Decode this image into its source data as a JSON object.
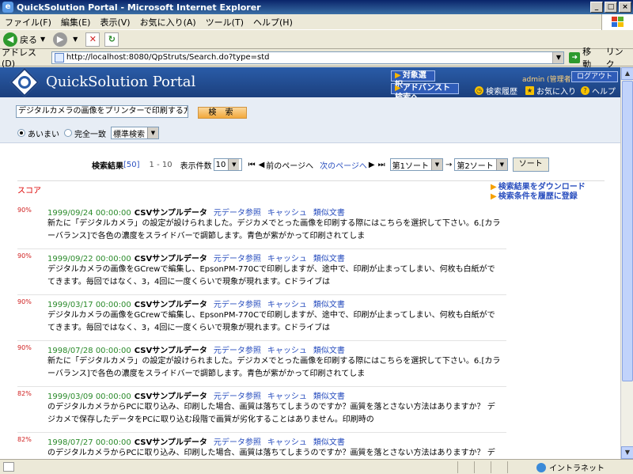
{
  "window": {
    "title": "QuickSolution Portal - Microsoft Internet Explorer",
    "buttons": [
      "_",
      "□",
      "×"
    ]
  },
  "menu": [
    "ファイル(F)",
    "編集(E)",
    "表示(V)",
    "お気に入り(A)",
    "ツール(T)",
    "ヘルプ(H)"
  ],
  "toolbar": {
    "back_label": "戻る"
  },
  "address": {
    "label": "アドレス(D)",
    "url": "http://localhost:8080/QpStruts/Search.do?type=std",
    "go_label": "移動",
    "links_label": "リンク"
  },
  "header": {
    "brand": "QuickSolution Portal",
    "nav": [
      "対象選択",
      "アドバンスト検索へ"
    ],
    "admin": "admin (管理者)",
    "logout": "ログアウト",
    "util_links": [
      "検索履歴",
      "お気に入り",
      "ヘルプ"
    ]
  },
  "search": {
    "query": "デジタルカメラの画像をプリンターで印刷する方法は",
    "button": "検 索",
    "match_options": [
      "あいまい",
      "完全一致"
    ],
    "mode_value": "標準検索"
  },
  "results_bar": {
    "label": "検索結果",
    "count": "[50]",
    "range": "1 - 10",
    "per_page_label": "表示件数",
    "per_page_value": "10",
    "prev": "前のページへ",
    "next": "次のページへ",
    "sort1": "第1ソート",
    "sort_arrow": "→",
    "sort2": "第2ソート",
    "sort_button": "ソート"
  },
  "score_header": "スコア",
  "side_links": [
    "検索結果をダウンロード",
    "検索条件を履歴に登録"
  ],
  "results": [
    {
      "score": "90",
      "date": "1999/09/24 00:00:00",
      "title": "CSVサンプルデータ",
      "links": [
        "元データ参照",
        "キャッシュ",
        "類似文書"
      ],
      "snippet": "新たに「デジタルカメラ」の設定が設けられました。デジカメでとった画像を印刷する際にはこちらを選択して下さい。6.[カラーバランス]で各色の濃度をスライドバーで調節します。青色が紫がかって印刷されてしま"
    },
    {
      "score": "90",
      "date": "1999/09/22 00:00:00",
      "title": "CSVサンプルデータ",
      "links": [
        "元データ参照",
        "キャッシュ",
        "類似文書"
      ],
      "snippet": "デジタルカメラの画像をGCrewで編集し、EpsonPM-770Cで印刷しますが、途中で、印刷が止まってしまい、何枚も白紙がでてきます。毎回ではなく、3，4回に一度くらいで現象が現れます。Cドライブは"
    },
    {
      "score": "90",
      "date": "1999/03/17 00:00:00",
      "title": "CSVサンプルデータ",
      "links": [
        "元データ参照",
        "キャッシュ",
        "類似文書"
      ],
      "snippet": "デジタルカメラの画像をGCrewで編集し、EpsonPM-770Cで印刷しますが、途中で、印刷が止まってしまい、何枚も白紙がでてきます。毎回ではなく、3，4回に一度くらいで現象が現れます。Cドライブは"
    },
    {
      "score": "90",
      "date": "1998/07/28 00:00:00",
      "title": "CSVサンプルデータ",
      "links": [
        "元データ参照",
        "キャッシュ",
        "類似文書"
      ],
      "snippet": "新たに「デジタルカメラ」の設定が設けられました。デジカメでとった画像を印刷する際にはこちらを選択して下さい。6.[カラーバランス]で各色の濃度をスライドバーで調節します。青色が紫がかって印刷されてしま"
    },
    {
      "score": "82",
      "date": "1999/03/09 00:00:00",
      "title": "CSVサンプルデータ",
      "links": [
        "元データ参照",
        "キャッシュ",
        "類似文書"
      ],
      "snippet": "のデジタルカメラからPCに取り込み、印刷した場合、画質は落ちてしまうのですか？画質を落とさない方法はありますか？ デジカメで保存したデータをPCに取り込む段階で画質が劣化することはありません。印刷時の"
    },
    {
      "score": "82",
      "date": "1998/07/27 00:00:00",
      "title": "CSVサンプルデータ",
      "links": [
        "元データ参照",
        "キャッシュ",
        "類似文書"
      ],
      "snippet": "のデジタルカメラからPCに取り込み、印刷した場合、画質は落ちてしまうのですか？画質を落とさない方法はありますか？ デジカメで保存したデータをPCに取り込む段階で画質が劣化することはありません。印刷時の"
    }
  ],
  "status": {
    "zone": "イントラネット"
  },
  "percent_sign": "%"
}
